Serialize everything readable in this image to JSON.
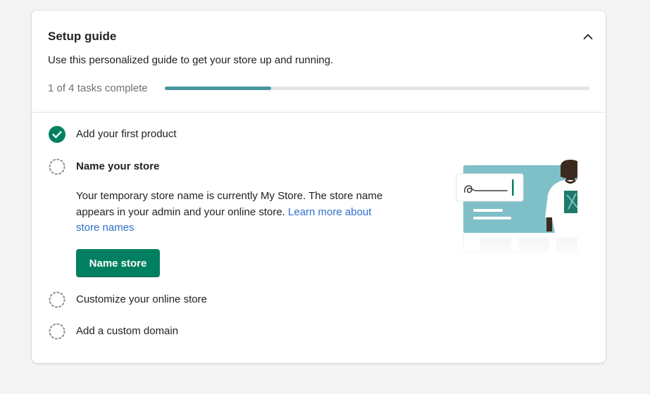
{
  "setup_guide": {
    "title": "Setup guide",
    "subtitle": "Use this personalized guide to get your store up and running.",
    "collapse_icon": "chevron-up-icon",
    "progress": {
      "label": "1 of 4 tasks complete",
      "completed": 1,
      "total": 4,
      "fraction": 0.25,
      "fill_color": "#47959f"
    },
    "tasks": [
      {
        "label": "Add your first product",
        "status": "complete",
        "icon": "checkmark-circle-icon"
      },
      {
        "label": "Name your store",
        "status": "active",
        "icon": "dashed-circle-icon"
      },
      {
        "label": "Customize your online store",
        "status": "incomplete",
        "icon": "dashed-circle-icon"
      },
      {
        "label": "Add a custom domain",
        "status": "incomplete",
        "icon": "dashed-circle-icon"
      }
    ],
    "active_task": {
      "description": "Your temporary store name is currently My Store. The store name appears in your admin and your online store.",
      "link_text": "Learn more about store names",
      "button_label": "Name store",
      "button_color": "#008060"
    }
  },
  "colors": {
    "accent": "#008060",
    "link": "#2c6ecb",
    "page_background": "#f4f4f4",
    "illustration_teal": "#7fbfc8"
  }
}
